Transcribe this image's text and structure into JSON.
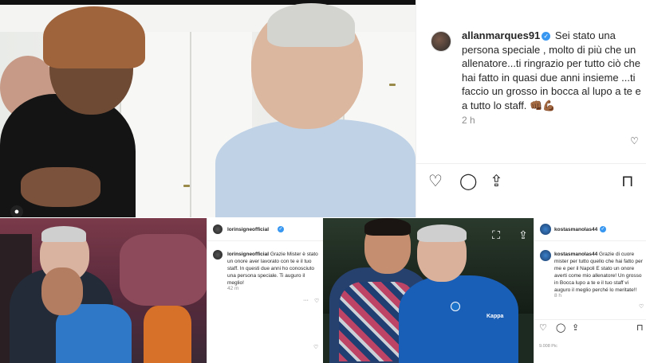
{
  "post_main": {
    "username": "allanmarques91",
    "caption": "Sei stato una persona speciale , molto di più che un allenatore...ti ringrazio per tutto ciò che hai fatto in quasi due anni insieme ...ti faccio un grosso in bocca al lupo a te e a tutto lo staff. 👊🏾💪🏾",
    "time": "2 h",
    "icons": [
      "heart-icon",
      "comment-icon",
      "share-icon",
      "bookmark-icon"
    ]
  },
  "post_insigne": {
    "username": "lorinsigneofficial",
    "caption": "Grazie Mister è stato un onore aver lavorato con te e il tuo staff. In questi due anni ho conosciuto una persona speciale. Ti auguro il meglio!",
    "time": "42 m"
  },
  "post_manolas": {
    "username": "kostasmanolas44",
    "caption": "Grazie di cuore mister per tutto quello che hai fatto per me e per il Napoli E stato un onore averti come mio allenatore! Un grosso in Bocca lupo a te e il tuo staff vi auguro il meglio perché lo meritate!!",
    "time": "8 h",
    "likes": "9.008 Pic",
    "jersey_brand": "Kappa"
  },
  "colors": {
    "verified": "#3897f0",
    "text": "#262626",
    "muted": "#8e8e8e"
  }
}
